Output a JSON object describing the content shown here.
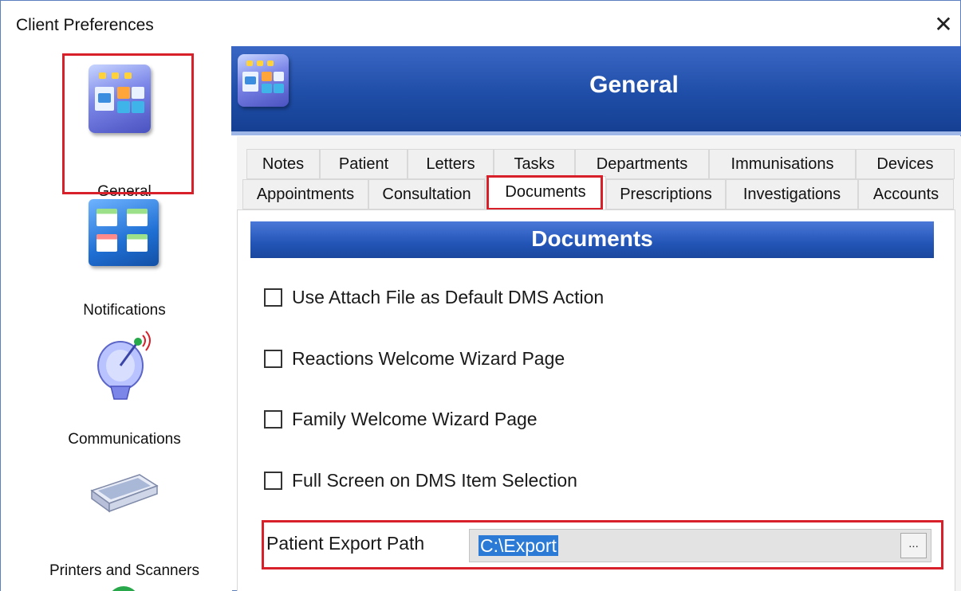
{
  "window": {
    "title": "Client Preferences",
    "close_glyph": "✕"
  },
  "sidebar": {
    "items": [
      {
        "label": "General",
        "icon": "general-board-icon",
        "selected": true
      },
      {
        "label": "Notifications",
        "icon": "notifications-icon"
      },
      {
        "label": "Communications",
        "icon": "satellite-dish-icon"
      },
      {
        "label": "Printers and Scanners",
        "icon": "scanner-icon"
      }
    ]
  },
  "banner": {
    "title": "General",
    "icon": "general-board-icon"
  },
  "tabs": {
    "row1": [
      {
        "label": "Notes"
      },
      {
        "label": "Patient"
      },
      {
        "label": "Letters"
      },
      {
        "label": "Tasks"
      },
      {
        "label": "Departments"
      },
      {
        "label": "Immunisations"
      },
      {
        "label": "Devices"
      }
    ],
    "row2": [
      {
        "label": "Appointments"
      },
      {
        "label": "Consultation"
      },
      {
        "label": "Documents",
        "active": true
      },
      {
        "label": "Prescriptions"
      },
      {
        "label": "Investigations"
      },
      {
        "label": "Accounts"
      }
    ]
  },
  "documents": {
    "header": "Documents",
    "options": [
      {
        "label": "Use Attach File as Default DMS Action",
        "checked": false
      },
      {
        "label": "Reactions Welcome Wizard Page",
        "checked": false
      },
      {
        "label": "Family Welcome Wizard Page",
        "checked": false
      },
      {
        "label": "Full Screen on DMS Item Selection",
        "checked": false
      }
    ],
    "export_path": {
      "label": "Patient Export Path",
      "value": "C:\\Export",
      "browse_label": "..."
    }
  },
  "colors": {
    "banner": "#1f4ea8",
    "highlight": "#d7202a",
    "selection": "#2a7ad6"
  }
}
